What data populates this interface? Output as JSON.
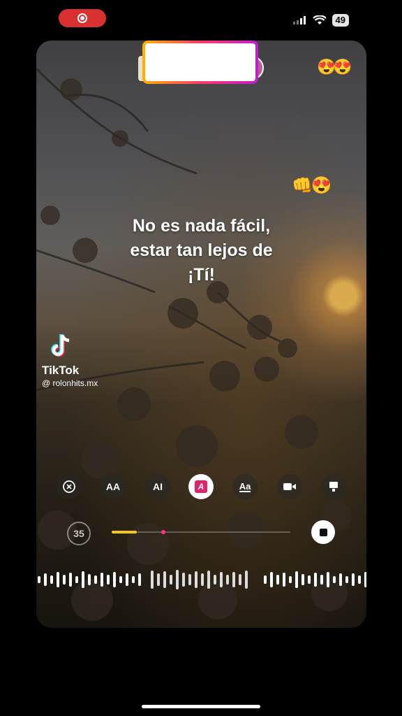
{
  "status_bar": {
    "battery": "49"
  },
  "lyrics": {
    "lines": [
      "No es nada fácil,",
      "estar tan lejos de",
      "¡Tí!"
    ]
  },
  "watermark": {
    "name": "TikTok",
    "user": "@ rolonhits.mx"
  },
  "emojis": {
    "top": "😍😍",
    "middle": "👊😍"
  },
  "toolbar": {
    "font_size_label": "AA",
    "align_label": "AI",
    "effect_label": "A",
    "aa_label": "Aa"
  },
  "playback": {
    "timer": "35",
    "progress_fraction": 0.14,
    "marker_fraction": 0.29
  },
  "colors": {
    "record": "#d8312f",
    "accent_pink": "#e1216a",
    "progress": "#f5c518"
  }
}
